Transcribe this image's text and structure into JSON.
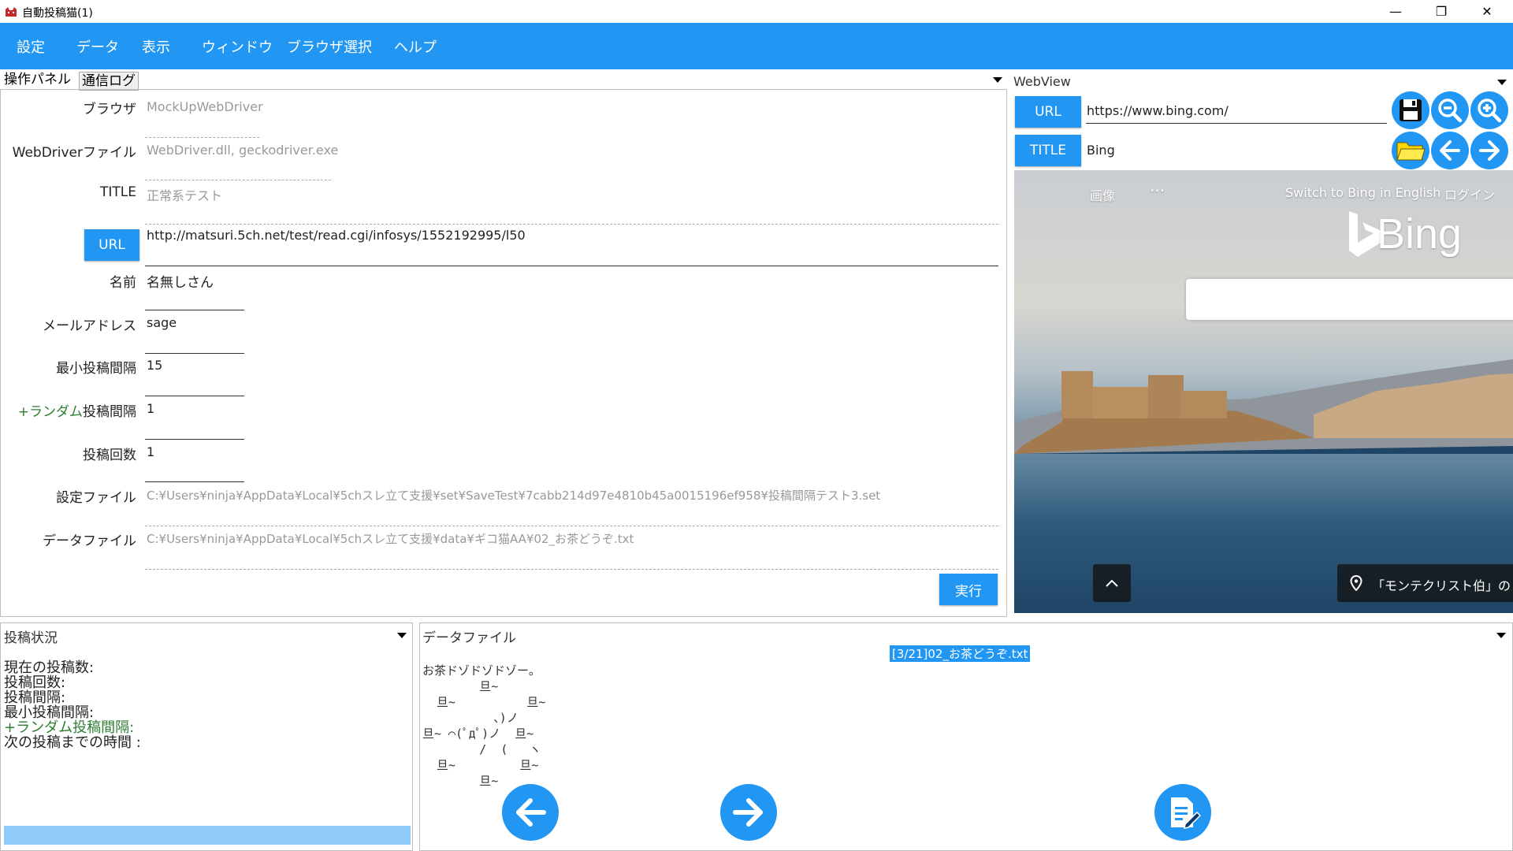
{
  "window": {
    "title": "自動投稿猫(1)",
    "minimize_glyph": "—",
    "restore_glyph": "❐",
    "close_glyph": "✕"
  },
  "menu": [
    "設定",
    "データ",
    "表示",
    "ウィンドウ",
    "ブラウザ選択",
    "ヘルプ"
  ],
  "tabs": {
    "active": "操作パネル",
    "inactive": "通信ログ"
  },
  "form": {
    "browser_label": "ブラウザ",
    "browser_value": "MockUpWebDriver",
    "webdriver_label": "WebDriverファイル",
    "webdriver_value": "WebDriver.dll, geckodriver.exe",
    "title_label": "TITLE",
    "title_value": "正常系テスト",
    "url_button": "URL",
    "url_value": "http://matsuri.5ch.net/test/read.cgi/infosys/1552192995/l50",
    "name_label": "名前",
    "name_value": "名無しさん",
    "mail_label": "メールアドレス",
    "mail_value": "sage",
    "min_interval_label": "最小投稿間隔",
    "min_interval_value": "15",
    "random_interval_label_prefix": "+ランダム",
    "random_interval_label_suffix": "投稿間隔",
    "random_interval_value": "1",
    "count_label": "投稿回数",
    "count_value": "1",
    "settings_file_label": "設定ファイル",
    "settings_file_value": "C:¥Users¥ninja¥AppData¥Local¥5chスレ立て支援¥set¥SaveTest¥7cabb214d97e4810b45a0015196ef958¥投稿間隔テスト3.set",
    "data_file_label": "データファイル",
    "data_file_value": "C:¥Users¥ninja¥AppData¥Local¥5chスレ立て支援¥data¥ギコ猫AA¥02_お茶どうぞ.txt",
    "execute_button": "実行"
  },
  "webview": {
    "header": "WebView",
    "url_button": "URL",
    "url_value": "https://www.bing.com/",
    "title_button": "TITLE",
    "title_value": "Bing",
    "page": {
      "nav_images": "画像",
      "nav_more": "···",
      "switch_lang": "Switch to Bing in English",
      "login": "ログイン",
      "logo_text": "Bing",
      "caption": "「モンテクリスト伯」の"
    }
  },
  "status_panel": {
    "header": "投稿状況",
    "lines": [
      "現在の投稿数:",
      "投稿回数:",
      "投稿間隔:",
      "最小投稿間隔:",
      "+ランダム投稿間隔:",
      "次の投稿までの時間 :"
    ]
  },
  "data_panel": {
    "header": "データファイル",
    "file_tag": "[3/21]02_お茶どうぞ.txt",
    "aa_text": "お茶ドゾドゾドゾー。\n        旦~\n  旦~          旦~\n          、)ノ\n旦~ ⌒(ﾟдﾟ)ノ  旦~\n        /  (   ヽ\n  旦~         旦~\n        旦~"
  },
  "colors": {
    "accent": "#2196F3",
    "progress": "#90CAF9",
    "folder": "#FFD600"
  }
}
